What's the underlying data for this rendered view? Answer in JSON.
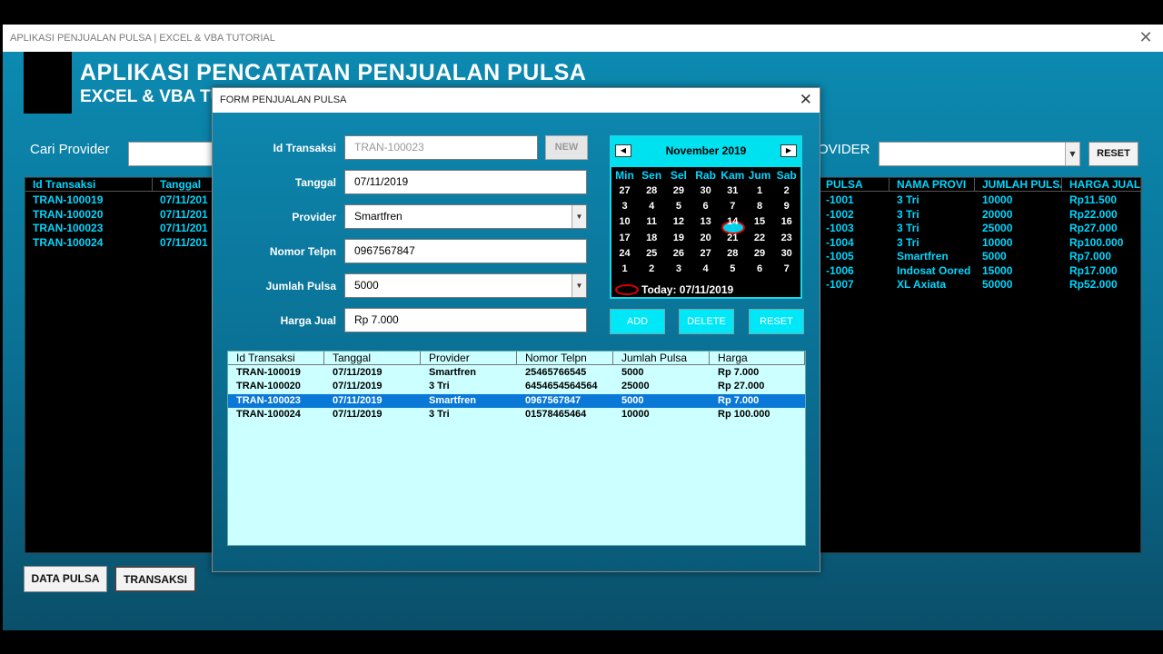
{
  "window": {
    "title": "APLIKASI PENJUALAN PULSA | EXCEL & VBA TUTORIAL"
  },
  "header": {
    "title": "APLIKASI PENCATATAN PENJUALAN PULSA",
    "subtitle": "EXCEL & VBA TU"
  },
  "search": {
    "label": "Cari Provider",
    "value": ""
  },
  "provider_filter": {
    "label": "OVIDER",
    "value": "",
    "reset_label": "RESET"
  },
  "left_list": {
    "headers": [
      "Id Transaksi",
      "Tanggal"
    ],
    "rows": [
      [
        "TRAN-100019",
        "07/11/201"
      ],
      [
        "TRAN-100020",
        "07/11/201"
      ],
      [
        "TRAN-100023",
        "07/11/201"
      ],
      [
        "TRAN-100024",
        "07/11/201"
      ]
    ]
  },
  "right_list": {
    "headers": [
      "PULSA",
      "NAMA PROVI",
      "JUMLAH PULSA",
      "HARGA JUAL"
    ],
    "rows": [
      [
        "-1001",
        "3 Tri",
        "10000",
        "Rp11.500"
      ],
      [
        "-1002",
        "3 Tri",
        "20000",
        "Rp22.000"
      ],
      [
        "-1003",
        "3 Tri",
        "25000",
        "Rp27.000"
      ],
      [
        "-1004",
        "3 Tri",
        "10000",
        "Rp100.000"
      ],
      [
        "-1005",
        "Smartfren",
        "5000",
        "Rp7.000"
      ],
      [
        "-1006",
        "Indosat Oored",
        "15000",
        "Rp17.000"
      ],
      [
        "-1007",
        "XL Axiata",
        "50000",
        "Rp52.000"
      ]
    ]
  },
  "bottom_buttons": {
    "data_pulsa": "DATA PULSA",
    "transaksi": "TRANSAKSI"
  },
  "dialog": {
    "title": "FORM PENJUALAN PULSA",
    "fields": {
      "id": {
        "label": "Id Transaksi",
        "value": "TRAN-100023"
      },
      "tanggal": {
        "label": "Tanggal",
        "value": "07/11/2019"
      },
      "provider": {
        "label": "Provider",
        "value": "Smartfren"
      },
      "nomor": {
        "label": "Nomor Telpn",
        "value": "0967567847"
      },
      "jumlah": {
        "label": "Jumlah Pulsa",
        "value": "5000"
      },
      "harga": {
        "label": "Harga Jual",
        "value": "Rp 7.000"
      }
    },
    "new_label": "NEW",
    "add_label": "ADD",
    "delete_label": "DELETE",
    "reset_label": "RESET",
    "calendar": {
      "month": "November 2019",
      "dow": [
        "Min",
        "Sen",
        "Sel",
        "Rab",
        "Kam",
        "Jum",
        "Sab"
      ],
      "weeks": [
        [
          "27",
          "28",
          "29",
          "30",
          "31",
          "1",
          "2"
        ],
        [
          "3",
          "4",
          "5",
          "6",
          "7",
          "8",
          "9"
        ],
        [
          "10",
          "11",
          "12",
          "13",
          "14",
          "15",
          "16"
        ],
        [
          "17",
          "18",
          "19",
          "20",
          "21",
          "22",
          "23"
        ],
        [
          "24",
          "25",
          "26",
          "27",
          "28",
          "29",
          "30"
        ],
        [
          "1",
          "2",
          "3",
          "4",
          "5",
          "6",
          "7"
        ]
      ],
      "selected": "7",
      "today": "Today: 07/11/2019"
    },
    "grid": {
      "headers": [
        "Id Transaksi",
        "Tanggal",
        "Provider",
        "Nomor Telpn",
        "Jumlah Pulsa",
        "Harga"
      ],
      "rows": [
        [
          "TRAN-100019",
          "07/11/2019",
          "Smartfren",
          "25465766545",
          "5000",
          "Rp 7.000"
        ],
        [
          "TRAN-100020",
          "07/11/2019",
          "3 Tri",
          "6454654564564",
          "25000",
          "Rp 27.000"
        ],
        [
          "TRAN-100023",
          "07/11/2019",
          "Smartfren",
          "0967567847",
          "5000",
          "Rp 7.000"
        ],
        [
          "TRAN-100024",
          "07/11/2019",
          "3 Tri",
          "01578465464",
          "10000",
          "Rp 100.000"
        ]
      ],
      "selected_row": 2
    }
  }
}
